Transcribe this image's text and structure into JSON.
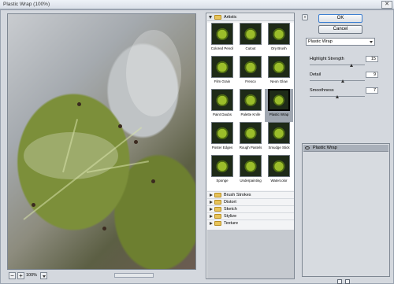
{
  "window": {
    "title": "Plastic Wrap (100%)",
    "close_glyph": "✕"
  },
  "status": {
    "zoom": "100%",
    "zoom_out": "−",
    "zoom_in": "+"
  },
  "gallery": {
    "expanded_category": "Artistic",
    "thumbnails": [
      {
        "label": "Colored Pencil"
      },
      {
        "label": "Cutout"
      },
      {
        "label": "Dry Brush"
      },
      {
        "label": "Film Grain"
      },
      {
        "label": "Fresco"
      },
      {
        "label": "Neon Glow"
      },
      {
        "label": "Paint Daubs"
      },
      {
        "label": "Palette Knife"
      },
      {
        "label": "Plastic Wrap",
        "selected": true
      },
      {
        "label": "Poster Edges"
      },
      {
        "label": "Rough Pastels"
      },
      {
        "label": "Smudge Stick"
      },
      {
        "label": "Sponge"
      },
      {
        "label": "Underpainting"
      },
      {
        "label": "Watercolor"
      }
    ],
    "collapsed_categories": [
      "Brush Strokes",
      "Distort",
      "Sketch",
      "Stylize",
      "Texture"
    ]
  },
  "panel": {
    "toggle_glyph": "»",
    "ok_label": "OK",
    "cancel_label": "Cancel",
    "filter_select": "Plastic Wrap",
    "params": [
      {
        "label": "Highlight Strength",
        "value": "15",
        "level": 0.75
      },
      {
        "label": "Detail",
        "value": "9",
        "level": 0.6
      },
      {
        "label": "Smoothness",
        "value": "7",
        "level": 0.5
      }
    ],
    "layer_name": "Plastic Wrap"
  },
  "colors": {
    "accent": "#3d7fd1",
    "selection": "#9fa6b0",
    "folder": "#e8c45a"
  }
}
